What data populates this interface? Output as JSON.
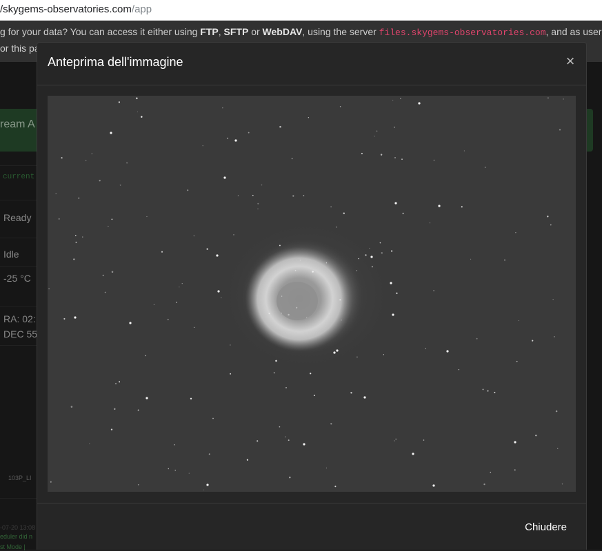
{
  "browser": {
    "url_host": "/skygems-observatories.com",
    "url_path": "/app"
  },
  "info": {
    "line1_part1": "g for your data? You can access it either using ",
    "ftp": "FTP",
    "sep1": ", ",
    "sftp": "SFTP",
    "sep2": " or ",
    "webdav": "WebDAV",
    "line1_part2": ", using the server ",
    "server": "files.skygems-observatories.com",
    "line1_part3": ", and as user (e",
    "line2": "or this pa"
  },
  "background": {
    "panel_title": "ream A",
    "code_snippet": "current",
    "status_ready": "Ready",
    "status_idle": "Idle",
    "temperature": "-25 °C",
    "ra": "RA: 02:",
    "dec": "DEC 55",
    "file_label": "103P_LI",
    "log_time": "-07-20 13:08",
    "log_line1": "eduler did n",
    "log_line2": "st Mode |"
  },
  "modal": {
    "title": "Anteprima dell'immagine",
    "close_symbol": "×",
    "footer_button": "Chiudere"
  },
  "image": {
    "subject": "nebula-preview"
  }
}
